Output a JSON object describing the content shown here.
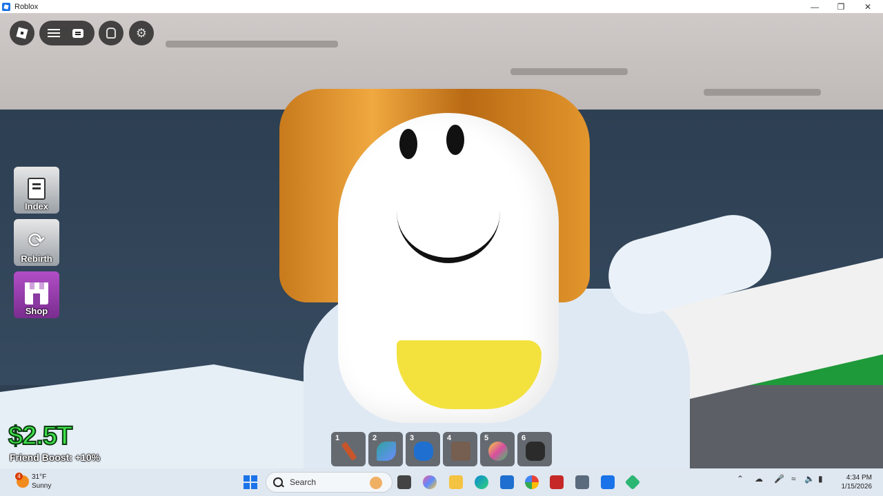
{
  "window": {
    "title": "Roblox",
    "controls": [
      "minimize",
      "maximize",
      "close"
    ]
  },
  "topbar": {
    "buttons": [
      "roblox-menu",
      "menu",
      "chat",
      "backpack",
      "settings"
    ]
  },
  "sidebar": {
    "items": [
      {
        "label": "Index",
        "icon": "book-icon"
      },
      {
        "label": "Rebirth",
        "icon": "refresh-icon"
      },
      {
        "label": "Shop",
        "icon": "store-icon"
      }
    ]
  },
  "stats": {
    "money": "$2.5T",
    "boost": "Friend Boost: +10%"
  },
  "hotbar": {
    "slots": [
      {
        "num": "1",
        "color": "#c8552a"
      },
      {
        "num": "2",
        "color": "#2fa3a0"
      },
      {
        "num": "3",
        "color": "#1f6fd1"
      },
      {
        "num": "4",
        "color": "#7a5b4a"
      },
      {
        "num": "5",
        "color": "#d94ea0"
      },
      {
        "num": "6",
        "color": "#2b2b2b"
      }
    ]
  },
  "taskbar": {
    "weather": {
      "badge": "4",
      "temp": "31°F",
      "condition": "Sunny"
    },
    "search_placeholder": "Search",
    "clock": {
      "time": "4:34 PM",
      "date": "1/15/2026"
    }
  }
}
